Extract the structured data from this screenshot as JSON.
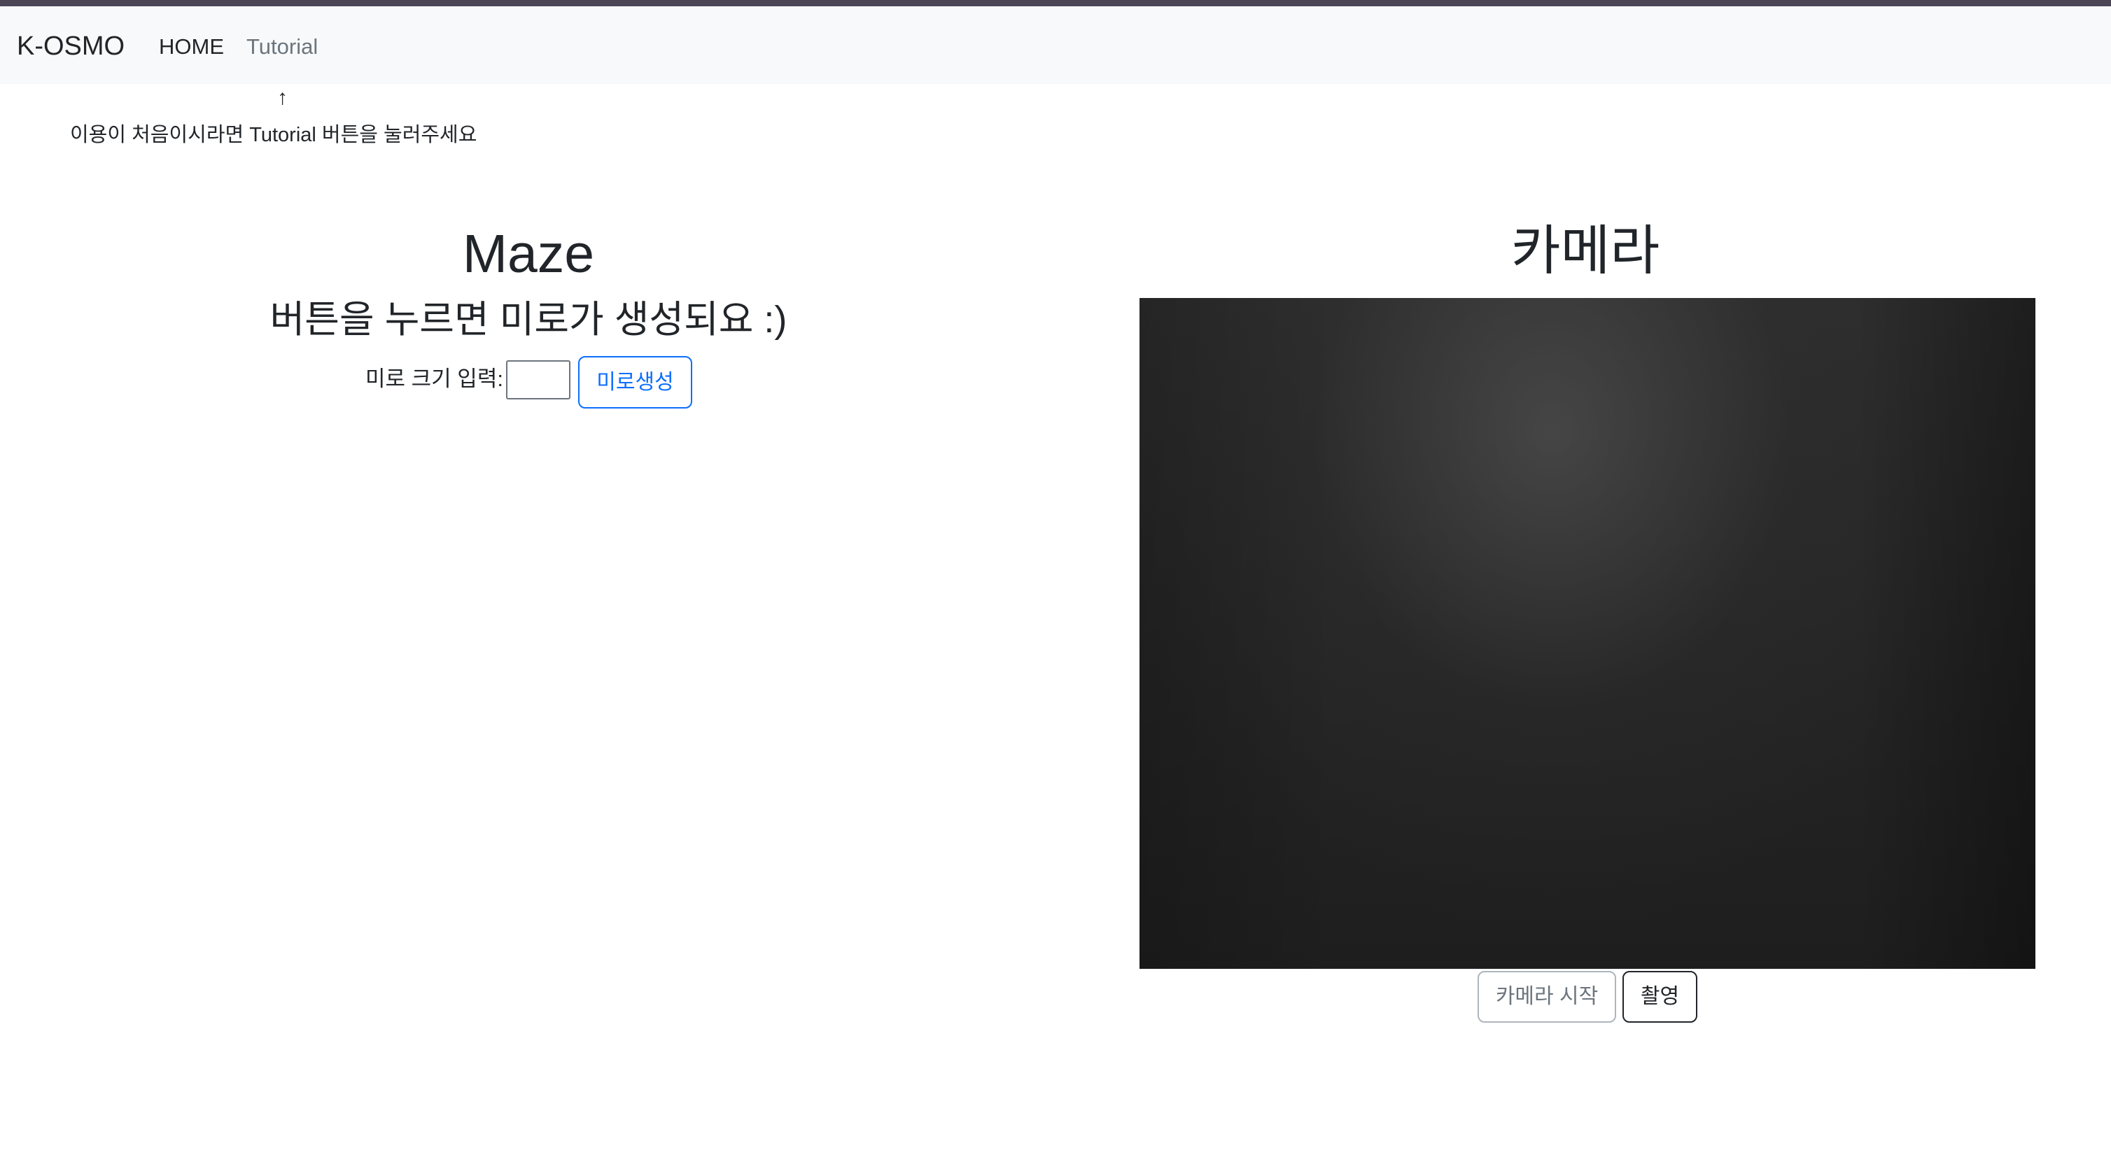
{
  "navbar": {
    "brand": "K-OSMO",
    "links": [
      {
        "label": "HOME"
      },
      {
        "label": "Tutorial"
      }
    ]
  },
  "hint": {
    "arrow": "↑",
    "text": "이용이 처음이시라면 Tutorial 버튼을 눌러주세요"
  },
  "maze": {
    "title": "Maze",
    "subtitle": "버튼을 누르면 미로가 생성되요 :)",
    "size_label": "미로 크기 입력:",
    "size_value": "",
    "generate_button": "미로생성"
  },
  "camera": {
    "title": "카메라",
    "start_button": "카메라 시작",
    "capture_button": "촬영"
  },
  "colors": {
    "primary": "#0d6efd",
    "navbar_bg": "#f8f9fa",
    "text": "#212529",
    "muted": "#6c757d"
  }
}
